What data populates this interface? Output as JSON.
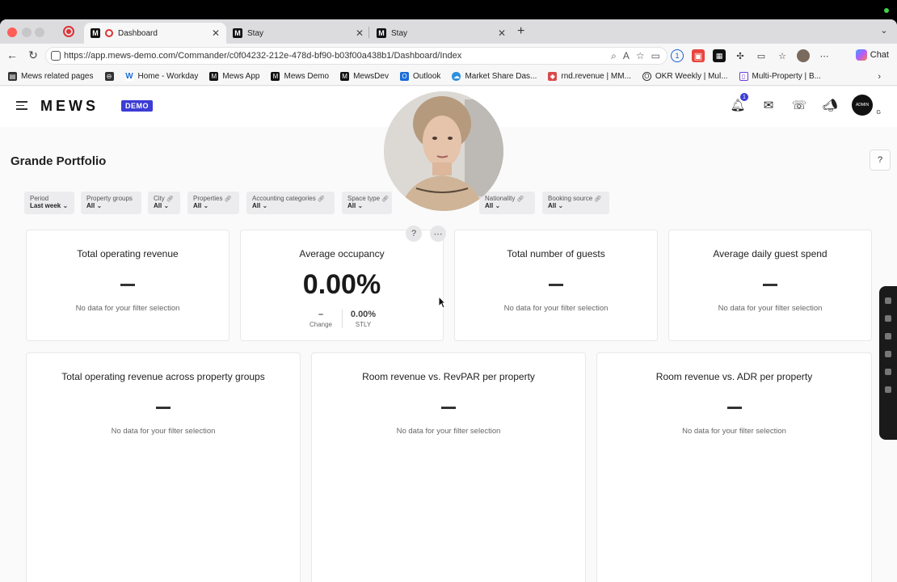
{
  "browser": {
    "tabs": [
      {
        "label": "Dashboard",
        "active": true
      },
      {
        "label": "Stay",
        "active": false
      },
      {
        "label": "Stay",
        "active": false
      }
    ],
    "url": "https://app.mews-demo.com/Commander/c0f04232-212e-478d-bf90-b03f00a438b1/Dashboard/Index",
    "chat_label": "Chat",
    "bookmarks": [
      {
        "label": "Mews related pages",
        "icon": "folder-icon"
      },
      {
        "label": "",
        "icon": "link-icon"
      },
      {
        "label": "Home - Workday",
        "icon": "workday-icon"
      },
      {
        "label": "Mews App",
        "icon": "mews-icon"
      },
      {
        "label": "Mews Demo",
        "icon": "mews-icon"
      },
      {
        "label": "MewsDev",
        "icon": "mews-icon"
      },
      {
        "label": "Outlook",
        "icon": "outlook-icon"
      },
      {
        "label": "Market Share Das...",
        "icon": "cloud-icon"
      },
      {
        "label": "rnd.revenue | MM...",
        "icon": "cube-icon"
      },
      {
        "label": "OKR Weekly | Mul...",
        "icon": "okr-icon"
      },
      {
        "label": "Multi-Property | B...",
        "icon": "multi-icon"
      }
    ]
  },
  "app": {
    "logo": "MEWS",
    "badge": "DEMO",
    "notification_count": "1",
    "user_initial": "G",
    "avatar_text": "ADMIN"
  },
  "page": {
    "title": "Grande Portfolio"
  },
  "filters": [
    {
      "label": "Period",
      "value": "Last week",
      "linked": false
    },
    {
      "label": "Property groups",
      "value": "All",
      "linked": false
    },
    {
      "label": "City",
      "value": "All",
      "linked": true
    },
    {
      "label": "Properties",
      "value": "All",
      "linked": true
    },
    {
      "label": "Accounting categories",
      "value": "All",
      "linked": true
    },
    {
      "label": "Space type",
      "value": "All",
      "linked": true
    },
    {
      "label": "Nationality",
      "value": "All",
      "linked": true
    },
    {
      "label": "Booking source",
      "value": "All",
      "linked": true
    }
  ],
  "no_data_text": "No data for your filter selection",
  "cards_top": [
    {
      "title": "Total operating revenue"
    },
    {
      "title": "Average occupancy",
      "value": "0.00%",
      "change_value": "–",
      "change_label": "Change",
      "stly_value": "0.00%",
      "stly_label": "STLY"
    },
    {
      "title": "Total number of guests"
    },
    {
      "title": "Average daily guest spend"
    }
  ],
  "cards_bottom": [
    {
      "title": "Total operating revenue across property groups"
    },
    {
      "title": "Room revenue vs. RevPAR per property"
    },
    {
      "title": "Room revenue vs. ADR per property"
    }
  ],
  "colors": {
    "accent": "#3c3cd6",
    "close_red": "#ff5f57"
  }
}
